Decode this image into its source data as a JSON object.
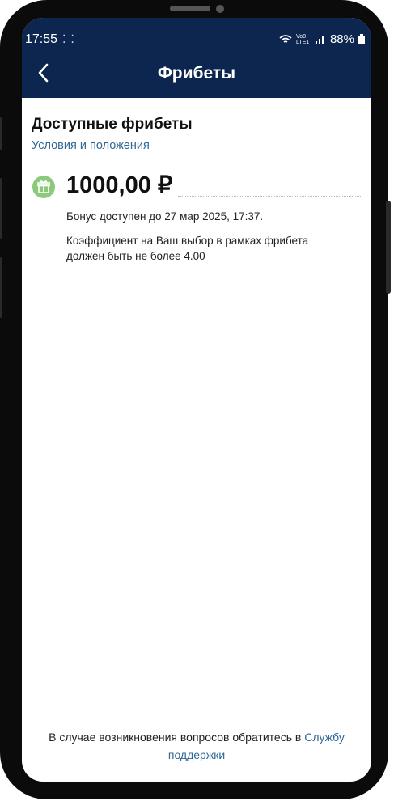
{
  "status": {
    "time": "17:55",
    "indicators": "⁚ ⁚",
    "network": "Vo8 LTE1",
    "battery": "88%"
  },
  "header": {
    "title": "Фрибеты"
  },
  "main": {
    "heading": "Доступные фрибеты",
    "terms_link": "Условия и положения",
    "freebet": {
      "amount": "1000,00 ₽",
      "valid_until": "Бонус доступен до 27 мар 2025, 17:37.",
      "condition": "Коэффициент на Ваш выбор в рамках фрибета должен быть не более 4.00"
    }
  },
  "footer": {
    "text": "В случае возникновения вопросов обратитесь в",
    "link": "Службу поддержки"
  },
  "colors": {
    "header_bg": "#0c2650",
    "link": "#2f6796",
    "gift_icon": "#8cc97a"
  }
}
